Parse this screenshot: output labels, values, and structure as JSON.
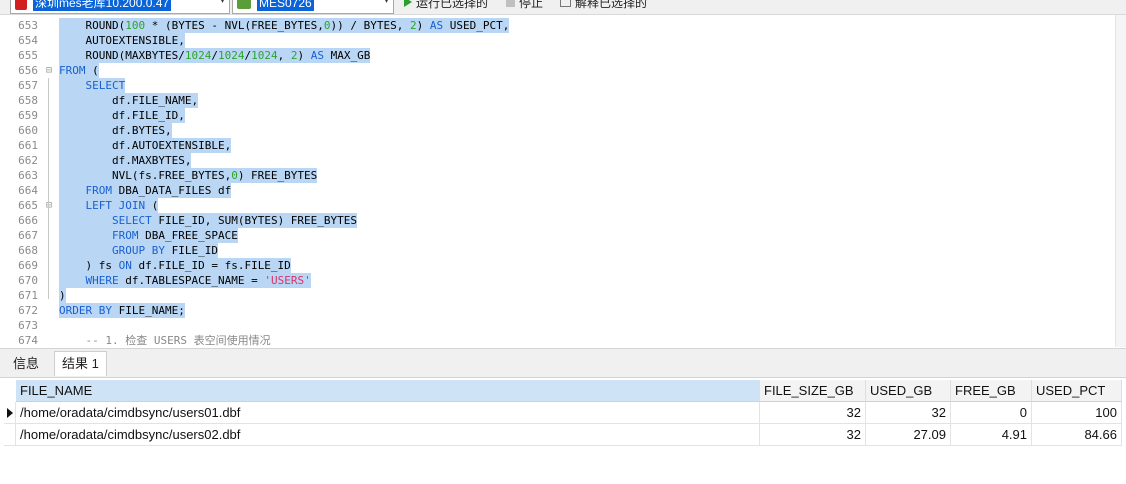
{
  "toolbar": {
    "connection": "深圳mes老库10.200.0.47",
    "database": "MES0726",
    "run_selected": "运行已选择的",
    "stop": "停止",
    "explain_selected": "解释已选择的"
  },
  "editor": {
    "lines": [
      {
        "n": "653",
        "fold": "",
        "hl": true,
        "parts": [
          [
            "",
            "    ROUND("
          ],
          [
            "num",
            "100"
          ],
          [
            "",
            " * (BYTES - NVL(FREE_BYTES,"
          ],
          [
            "num",
            "0"
          ],
          [
            "",
            ")) / BYTES, "
          ],
          [
            "num",
            "2"
          ],
          [
            "",
            ") "
          ],
          [
            "kw",
            "AS"
          ],
          [
            "",
            " USED_PCT,"
          ]
        ]
      },
      {
        "n": "654",
        "fold": "",
        "hl": true,
        "parts": [
          [
            "",
            "    AUTOEXTENSIBLE,"
          ]
        ]
      },
      {
        "n": "655",
        "fold": "",
        "hl": true,
        "parts": [
          [
            "",
            "    ROUND(MAXBYTES/"
          ],
          [
            "num",
            "1024"
          ],
          [
            "",
            "/"
          ],
          [
            "num",
            "1024"
          ],
          [
            "",
            "/"
          ],
          [
            "num",
            "1024"
          ],
          [
            "",
            ", "
          ],
          [
            "num",
            "2"
          ],
          [
            "",
            ") "
          ],
          [
            "kw",
            "AS"
          ],
          [
            "",
            " MAX_GB"
          ]
        ]
      },
      {
        "n": "656",
        "fold": "⊟",
        "hl": true,
        "parts": [
          [
            "kw",
            "FROM"
          ],
          [
            "",
            " ("
          ]
        ]
      },
      {
        "n": "657",
        "fold": "",
        "hl": true,
        "parts": [
          [
            "",
            "    "
          ],
          [
            "kw",
            "SELECT"
          ]
        ]
      },
      {
        "n": "658",
        "fold": "",
        "hl": true,
        "parts": [
          [
            "",
            "        df.FILE_NAME,"
          ]
        ]
      },
      {
        "n": "659",
        "fold": "",
        "hl": true,
        "parts": [
          [
            "",
            "        df.FILE_ID,"
          ]
        ]
      },
      {
        "n": "660",
        "fold": "",
        "hl": true,
        "parts": [
          [
            "",
            "        df.BYTES,"
          ]
        ]
      },
      {
        "n": "661",
        "fold": "",
        "hl": true,
        "parts": [
          [
            "",
            "        df.AUTOEXTENSIBLE,"
          ]
        ]
      },
      {
        "n": "662",
        "fold": "",
        "hl": true,
        "parts": [
          [
            "",
            "        df.MAXBYTES,"
          ]
        ]
      },
      {
        "n": "663",
        "fold": "",
        "hl": true,
        "parts": [
          [
            "",
            "        NVL(fs.FREE_BYTES,"
          ],
          [
            "num",
            "0"
          ],
          [
            "",
            ") FREE_BYTES"
          ]
        ]
      },
      {
        "n": "664",
        "fold": "",
        "hl": true,
        "parts": [
          [
            "",
            "    "
          ],
          [
            "kw",
            "FROM"
          ],
          [
            "",
            " DBA_DATA_FILES df"
          ]
        ]
      },
      {
        "n": "665",
        "fold": "⊟",
        "hl": true,
        "parts": [
          [
            "",
            "    "
          ],
          [
            "kw",
            "LEFT JOIN"
          ],
          [
            "",
            " ("
          ]
        ]
      },
      {
        "n": "666",
        "fold": "",
        "hl": true,
        "parts": [
          [
            "",
            "        "
          ],
          [
            "kw",
            "SELECT"
          ],
          [
            "",
            " FILE_ID, SUM(BYTES) FREE_BYTES"
          ]
        ]
      },
      {
        "n": "667",
        "fold": "",
        "hl": true,
        "parts": [
          [
            "",
            "        "
          ],
          [
            "kw",
            "FROM"
          ],
          [
            "",
            " DBA_FREE_SPACE"
          ]
        ]
      },
      {
        "n": "668",
        "fold": "",
        "hl": true,
        "parts": [
          [
            "",
            "        "
          ],
          [
            "kw",
            "GROUP BY"
          ],
          [
            "",
            " FILE_ID"
          ]
        ]
      },
      {
        "n": "669",
        "fold": "",
        "hl": true,
        "parts": [
          [
            "",
            "    ) fs "
          ],
          [
            "kw",
            "ON"
          ],
          [
            "",
            " df.FILE_ID = fs.FILE_ID"
          ]
        ]
      },
      {
        "n": "670",
        "fold": "",
        "hl": true,
        "parts": [
          [
            "",
            "    "
          ],
          [
            "kw",
            "WHERE"
          ],
          [
            "",
            " df.TABLESPACE_NAME = "
          ],
          [
            "str",
            "'USERS'"
          ]
        ]
      },
      {
        "n": "671",
        "fold": "",
        "hl": true,
        "parts": [
          [
            "",
            ")"
          ]
        ]
      },
      {
        "n": "672",
        "fold": "",
        "hl": true,
        "parts": [
          [
            "kw",
            "ORDER BY"
          ],
          [
            "",
            " FILE_NAME;"
          ]
        ]
      },
      {
        "n": "673",
        "fold": "",
        "hl": false,
        "parts": [
          [
            "",
            ""
          ]
        ]
      },
      {
        "n": "674",
        "fold": "",
        "hl": false,
        "parts": [
          [
            "cmt",
            "    -- 1. 检查 USERS 表空间使用情况"
          ]
        ]
      }
    ]
  },
  "tabs": [
    "信息",
    "结果 1"
  ],
  "grid": {
    "columns": [
      "FILE_NAME",
      "FILE_SIZE_GB",
      "USED_GB",
      "FREE_GB",
      "USED_PCT"
    ],
    "rows": [
      [
        "/home/oradata/cimdbsync/users01.dbf",
        "32",
        "32",
        "0",
        "100"
      ],
      [
        "/home/oradata/cimdbsync/users02.dbf",
        "32",
        "27.09",
        "4.91",
        "84.66"
      ]
    ]
  }
}
